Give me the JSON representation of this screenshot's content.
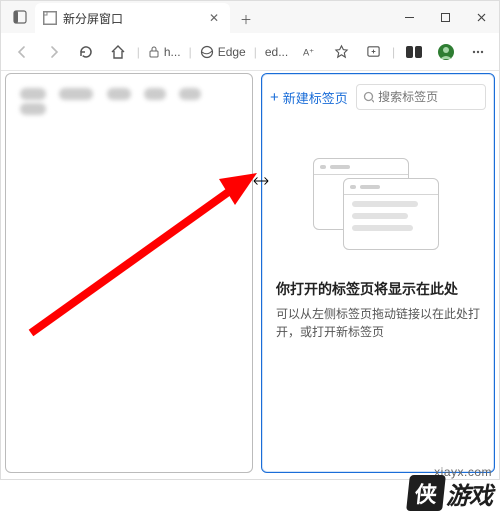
{
  "titlebar": {
    "tab_title": "新分屏窗口",
    "close_glyph": "✕",
    "newtab_glyph": "＋"
  },
  "window_controls": {
    "min": "—",
    "max": "▢",
    "close": "✕"
  },
  "toolbar": {
    "address_host": "h...",
    "edge_label": "Edge",
    "ed_label": "ed..."
  },
  "right_pane": {
    "new_tab_label": "新建标签页",
    "search_placeholder": "搜索标签页",
    "empty_title": "你打开的标签页将显示在此处",
    "empty_desc": "可以从左侧标签页拖动链接以在此处打开，或打开新标签页"
  },
  "watermark": {
    "url": "xiayx.com",
    "char": "侠",
    "text": "游戏"
  },
  "colors": {
    "accent": "#1a6dd8",
    "arrow": "#ff0000"
  }
}
